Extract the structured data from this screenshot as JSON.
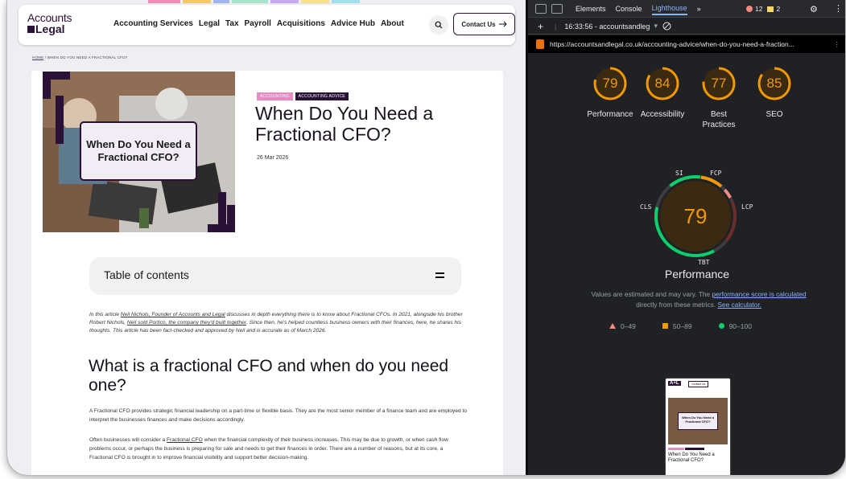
{
  "site": {
    "logo_line1": "Accounts",
    "logo_line2": "Legal",
    "nav": [
      "Accounting Services",
      "Legal",
      "Tax",
      "Payroll",
      "Acquisitions",
      "Advice Hub",
      "About"
    ],
    "contact_label": "Contact Us",
    "breadcrumb_home": "HOME",
    "breadcrumb_rest": " / WHEN DO YOU NEED A FRACTIONAL CFO?",
    "hero_overlay": "When Do You Need a Fractional CFO?",
    "tags": [
      "ACCOUNTING",
      "ACCOUNTING ADVICE"
    ],
    "post_title": "When Do You Need a Fractional CFO?",
    "post_date": "26 Mar 2026",
    "toc_label": "Table of contents",
    "intro": {
      "a": "In this article ",
      "link1": "Neil Nichols, Founder of Accounts and Legal",
      "b": " discusses in depth everything there is to know about Fractional CFOs. In 2021, alongside his brother Robert Nichols, ",
      "link2": "Neil sold Portico, the company they'd built together",
      "c": ". Since then, he's helped countless business owners with their finances, here, he shares his thoughts. This article has been fact-checked and approved by Neil and is accurate as of March 2026."
    },
    "h2": "What is a fractional CFO and when do you need one?",
    "p1": "A Fractional CFO provides strategic financial leadership on a part-time or flexible basis. They are the most senior member of a finance team and are employed to interpret the businesses finances and make decisions accordingly.",
    "p2": {
      "a": "Often businesses will consider a ",
      "link": "Fractional CFO",
      "b": " when the financial complexity of their business increases. This may be due to growth, or when cash flow problems occur, or perhaps the business is preparing for sale and needs to get their finances in order. There are a number of reasons, but at its core, a Fractional CFO is brought in to improve financial visibility and support better decision-making."
    }
  },
  "devtools": {
    "tabs": [
      "Elements",
      "Console",
      "Lighthouse",
      "»"
    ],
    "active_tab": "Lighthouse",
    "errors": "12",
    "warnings": "2",
    "session": "16:33:56 - accountsandleg",
    "url": "https://accountsandlegal.co.uk/accounting-advice/when-do-you-need-a-fraction...",
    "scores": [
      {
        "label": "Performance",
        "value": "79"
      },
      {
        "label": "Accessibility",
        "value": "84"
      },
      {
        "label": "Best Practices",
        "value": "77"
      },
      {
        "label": "SEO",
        "value": "85"
      }
    ],
    "perf_score": "79",
    "metrics": [
      "SI",
      "FCP",
      "LCP",
      "TBT",
      "CLS"
    ],
    "perf_title": "Performance",
    "note_a": "Values are estimated and may vary. The ",
    "note_link1": "performance score is calculated",
    "note_b": " directly from these metrics. ",
    "note_link2": "See calculator.",
    "legend": [
      "0–49",
      "50–89",
      "90–100"
    ],
    "thumb_title": "When Do You Need a Fractional CFO?",
    "thumb_contact": "Contact Us",
    "thumb_logo": "A+L",
    "colors": {
      "accent": "#2a1237",
      "score_orange": "#f29900",
      "score_green": "#0cce6b",
      "score_red": "#f28b82",
      "tag_pink": "#e78ac3",
      "tag_dark": "#2a1237"
    }
  }
}
